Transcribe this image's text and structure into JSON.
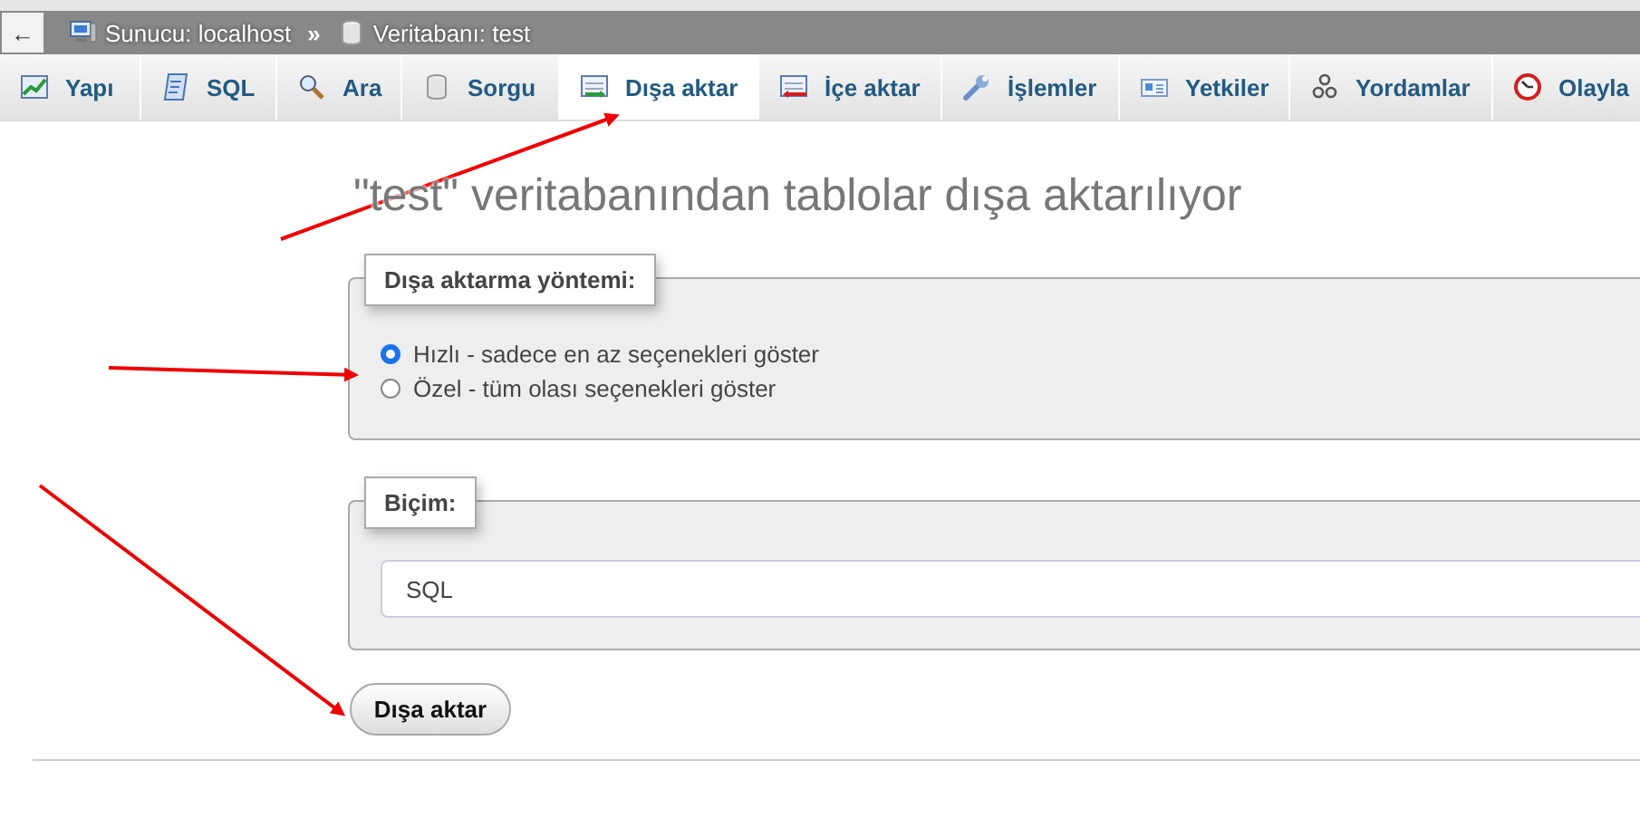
{
  "breadcrumb": {
    "back": "←",
    "items": [
      {
        "kind": "server",
        "label": "Sunucu: localhost"
      },
      {
        "kind": "database",
        "label": "Veritabanı: test"
      }
    ],
    "separator": "»"
  },
  "tabs": [
    {
      "label": "Yapı",
      "kind": "structure",
      "selected": false
    },
    {
      "label": "SQL",
      "kind": "sql",
      "selected": false
    },
    {
      "label": "Ara",
      "kind": "search",
      "selected": false
    },
    {
      "label": "Sorgu",
      "kind": "query",
      "selected": false
    },
    {
      "label": "Dışa aktar",
      "kind": "export",
      "selected": true
    },
    {
      "label": "İçe aktar",
      "kind": "import",
      "selected": false
    },
    {
      "label": "İşlemler",
      "kind": "operations",
      "selected": false
    },
    {
      "label": "Yetkiler",
      "kind": "privileges",
      "selected": false
    },
    {
      "label": "Yordamlar",
      "kind": "routines",
      "selected": false
    },
    {
      "label": "Olayla",
      "kind": "events",
      "selected": false
    }
  ],
  "heading": "\"test\" veritabanından tablolar dışa aktarılıyor",
  "method": {
    "legend": "Dışa aktarma yöntemi:",
    "options": [
      {
        "label": "Hızlı - sadece en az seçenekleri göster",
        "selected": true
      },
      {
        "label": "Özel - tüm olası seçenekleri göster",
        "selected": false
      }
    ]
  },
  "format": {
    "legend": "Biçim:",
    "value": "SQL"
  },
  "submit": "Dışa aktar"
}
